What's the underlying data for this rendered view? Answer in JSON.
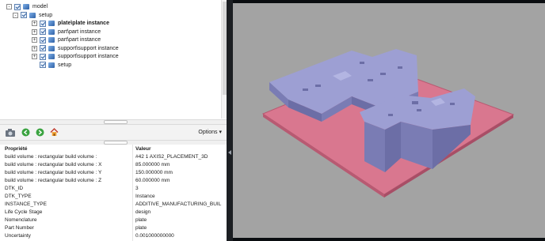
{
  "tree": {
    "items": [
      {
        "label": "model",
        "expander": "-",
        "bold": false
      },
      {
        "label": "setup",
        "expander": "-",
        "bold": false
      },
      {
        "label": "plate\\plate instance",
        "expander": "+",
        "bold": true
      },
      {
        "label": "part\\part instance",
        "expander": "+",
        "bold": false
      },
      {
        "label": "part\\part instance",
        "expander": "+",
        "bold": false
      },
      {
        "label": "support\\support instance",
        "expander": "+",
        "bold": false
      },
      {
        "label": "support\\support instance",
        "expander": "+",
        "bold": false
      },
      {
        "label": "setup",
        "expander": "",
        "bold": false
      }
    ]
  },
  "toolbar": {
    "options_label": "Options",
    "options_arrow": "▾"
  },
  "properties": {
    "header": {
      "name": "Propriété",
      "value": "Valeur"
    },
    "rows": [
      {
        "name": "build volume : rectangular build volume :",
        "value": "#42 1 AXIS2_PLACEMENT_3D"
      },
      {
        "name": "build volume : rectangular build volume : X",
        "value": "85.000000 mm"
      },
      {
        "name": "build volume : rectangular build volume : Y",
        "value": "150.000000 mm"
      },
      {
        "name": "build volume : rectangular build volume : Z",
        "value": "60.000000 mm"
      },
      {
        "name": "DTK_ID",
        "value": "3"
      },
      {
        "name": "DTK_TYPE",
        "value": "Instance"
      },
      {
        "name": "INSTANCE_TYPE",
        "value": "ADDITIVE_MANUFACTURING_BUIL"
      },
      {
        "name": "Life Cycle Stage",
        "value": "design"
      },
      {
        "name": "Nomenclature",
        "value": "plate"
      },
      {
        "name": "Part Number",
        "value": "plate"
      },
      {
        "name": "Uncertainty",
        "value": "0.001000000000"
      }
    ]
  },
  "colors": {
    "viewport_bg": "#a3a3a3",
    "build_plate": "#d9778f",
    "parts": "#9d9fd3"
  }
}
